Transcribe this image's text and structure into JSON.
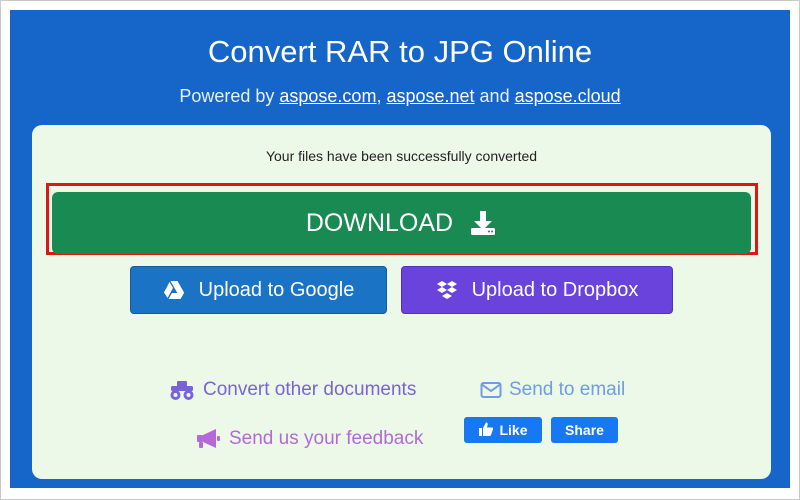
{
  "header": {
    "title": "Convert RAR to JPG Online",
    "powered_prefix": "Powered by ",
    "links": [
      "aspose.com",
      "aspose.net",
      "aspose.cloud"
    ],
    "separator": ", ",
    "conjunction": " and "
  },
  "result": {
    "status": "Your files have been successfully converted",
    "download_label": "DOWNLOAD",
    "upload_google_label": "Upload to Google",
    "upload_dropbox_label": "Upload to Dropbox"
  },
  "links": {
    "convert_other": "Convert other documents",
    "send_email": "Send to email",
    "feedback": "Send us your feedback"
  },
  "social": {
    "like": "Like",
    "share": "Share"
  },
  "icons": {
    "download": "download-tray-icon",
    "google_drive": "google-drive-icon",
    "dropbox": "dropbox-icon",
    "convert": "monster-truck-icon",
    "email": "envelope-icon",
    "feedback": "megaphone-icon",
    "like": "thumbs-up-icon"
  },
  "colors": {
    "hero_background": "#1566c8",
    "card_background": "#ecf8e8",
    "download_button": "#1a8a53",
    "highlight_border": "#e01616",
    "google_button": "#1a73c5",
    "dropbox_button": "#6a42dc",
    "facebook_blue": "#1877f2"
  }
}
